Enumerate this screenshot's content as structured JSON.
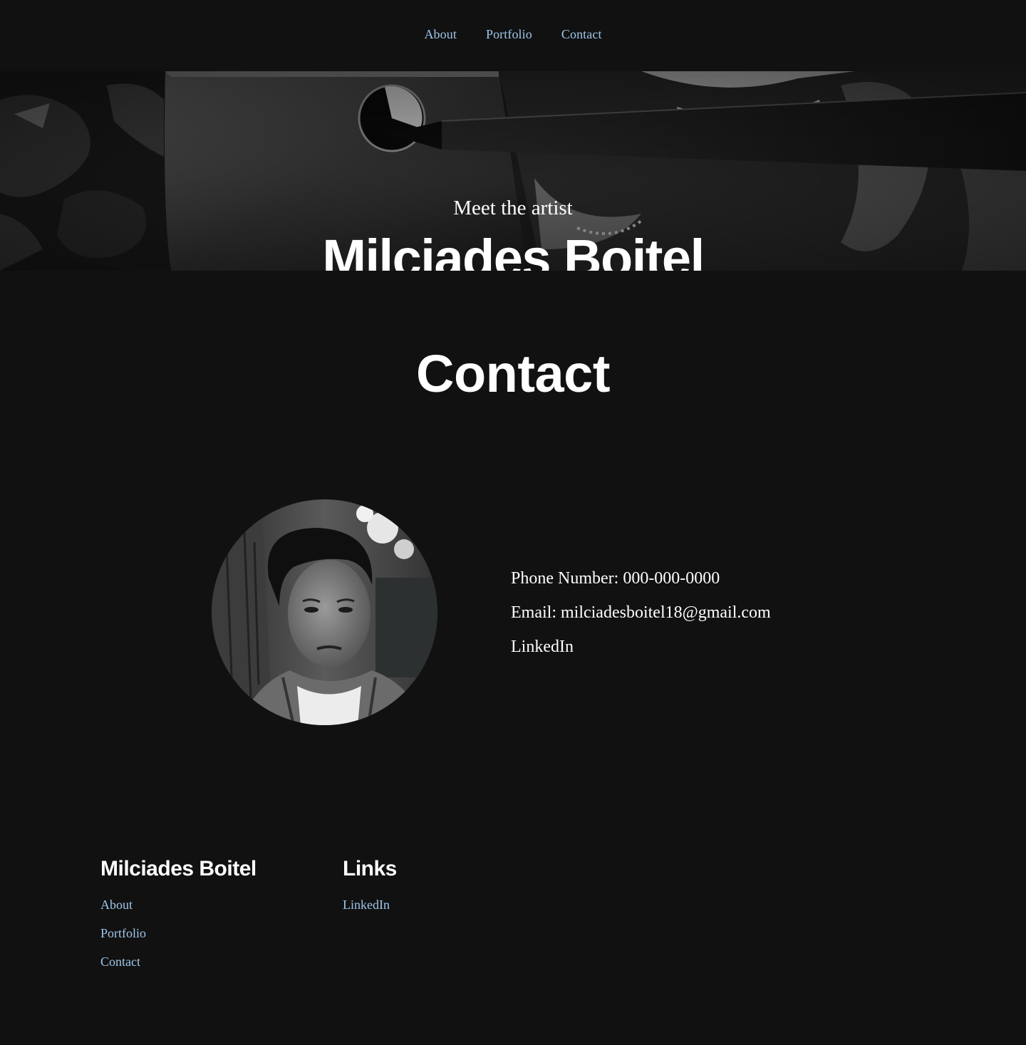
{
  "nav": {
    "items": [
      {
        "label": "About"
      },
      {
        "label": "Portfolio"
      },
      {
        "label": "Contact"
      }
    ]
  },
  "hero": {
    "subtitle": "Meet the artist",
    "title": "Milciades Boitel"
  },
  "main": {
    "heading": "Contact",
    "contact": {
      "phone": "Phone Number: 000-000-0000",
      "email": "Email: milciadesboitel18@gmail.com",
      "linkedin": "LinkedIn"
    }
  },
  "footer": {
    "col1": {
      "heading": "Milciades Boitel",
      "links": [
        {
          "label": "About"
        },
        {
          "label": "Portfolio"
        },
        {
          "label": "Contact"
        }
      ]
    },
    "col2": {
      "heading": "Links",
      "links": [
        {
          "label": "LinkedIn"
        }
      ]
    }
  },
  "colors": {
    "background": "#111111",
    "link": "#9fc6ea",
    "text": "#ffffff"
  }
}
